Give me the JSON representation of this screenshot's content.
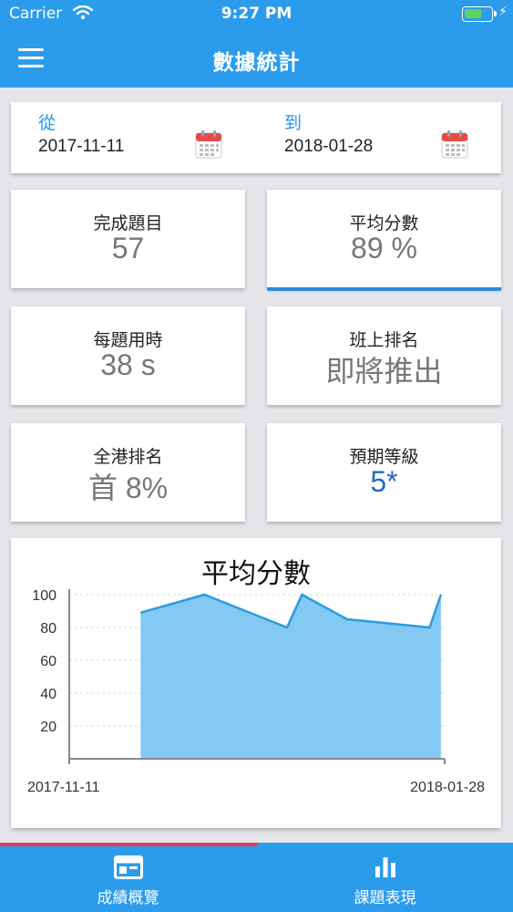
{
  "status_bar": {
    "carrier": "Carrier",
    "time": "9:27 PM"
  },
  "nav": {
    "title": "數據統計"
  },
  "dates": {
    "from_label": "從",
    "from_value": "2017-11-11",
    "to_label": "到",
    "to_value": "2018-01-28"
  },
  "stats": [
    {
      "label": "完成題目",
      "value": "57"
    },
    {
      "label": "平均分數",
      "value": "89 %"
    },
    {
      "label": "每題用時",
      "value": "38 s"
    },
    {
      "label": "班上排名",
      "value": "即將推出"
    },
    {
      "label": "全港排名",
      "value": "首 8%"
    },
    {
      "label": "預期等級",
      "value": "5*"
    }
  ],
  "colors": {
    "primary": "#2b9cec",
    "accent": "#e8375d",
    "chart_fill": "#7cc6f2",
    "chart_line": "#2a9ce0",
    "highlight": "#1e6fc9"
  },
  "chart_data": {
    "type": "area",
    "title": "平均分數",
    "xlabel": "",
    "ylabel": "",
    "x_tick_labels": [
      "2017-11-11",
      "2018-01-28"
    ],
    "yticks": [
      20,
      40,
      60,
      80,
      100
    ],
    "ylim": [
      0,
      100
    ],
    "grid": true,
    "series": [
      {
        "x": [
          0.19,
          0.36,
          0.58,
          0.62,
          0.74,
          0.96,
          0.99
        ],
        "values": [
          89,
          100,
          80,
          100,
          85,
          80,
          100
        ]
      }
    ]
  },
  "tabs": [
    {
      "label": "成績概覽",
      "icon": "dashboard-icon",
      "active": true
    },
    {
      "label": "課題表現",
      "icon": "bar-chart-icon",
      "active": false
    }
  ]
}
